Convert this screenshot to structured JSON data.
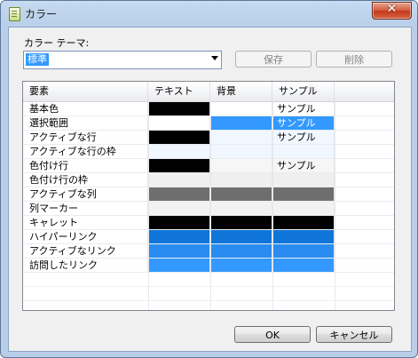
{
  "window": {
    "title": "カラー",
    "close_glyph": "✕"
  },
  "theme": {
    "label": "カラー テーマ:",
    "selected": "標準"
  },
  "buttons": {
    "save": "保存",
    "delete": "削除",
    "ok": "OK",
    "cancel": "キャンセル"
  },
  "table": {
    "headers": [
      "要素",
      "テキスト",
      "背景",
      "サンプル"
    ],
    "rows": [
      {
        "name": "基本色",
        "text_color": "#000000",
        "bg_color": "#ffffff",
        "sample": "サンプル",
        "sample_fg": "#000000",
        "sample_bg": "#ffffff"
      },
      {
        "name": "選択範囲",
        "text_color": "#ffffff",
        "bg_color": "#3399ff",
        "sample": "サンプル",
        "sample_fg": "#ffffff",
        "sample_bg": "#3399ff"
      },
      {
        "name": "アクティブな行",
        "text_color": "#000000",
        "bg_color": "#f0f7ff",
        "sample": "サンプル",
        "sample_fg": "#000000",
        "sample_bg": "#f0f7ff"
      },
      {
        "name": "アクティブな行の枠",
        "text_color": "#f0f7ff",
        "bg_color": "#f0f7ff",
        "sample": "",
        "sample_fg": "#000000",
        "sample_bg": "#f0f7ff"
      },
      {
        "name": "色付け行",
        "text_color": "#000000",
        "bg_color": "#f6f6f6",
        "sample": "サンプル",
        "sample_fg": "#000000",
        "sample_bg": "#f6f6f6"
      },
      {
        "name": "色付け行の枠",
        "text_color": "#efefef",
        "bg_color": "#efefef",
        "sample": "",
        "sample_fg": "#000000",
        "sample_bg": "#efefef"
      },
      {
        "name": "アクティブな列",
        "text_color": "#6e6e6e",
        "bg_color": "#6e6e6e",
        "sample": "",
        "sample_fg": "#000000",
        "sample_bg": "#6e6e6e"
      },
      {
        "name": "列マーカー",
        "text_color": "#f2f2f2",
        "bg_color": "#f2f2f2",
        "sample": "",
        "sample_fg": "#000000",
        "sample_bg": "#f2f2f2"
      },
      {
        "name": "キャレット",
        "text_color": "#000000",
        "bg_color": "#000000",
        "sample": "",
        "sample_fg": "#000000",
        "sample_bg": "#000000"
      },
      {
        "name": "ハイパーリンク",
        "text_color": "#0f75d9",
        "bg_color": "#0f75d9",
        "sample": "",
        "sample_fg": "#000000",
        "sample_bg": "#0f75d9"
      },
      {
        "name": "アクティブなリンク",
        "text_color": "#2a8cf0",
        "bg_color": "#2a8cf0",
        "sample": "",
        "sample_fg": "#000000",
        "sample_bg": "#2a8cf0"
      },
      {
        "name": "訪問したリンク",
        "text_color": "#3399ff",
        "bg_color": "#3399ff",
        "sample": "",
        "sample_fg": "#000000",
        "sample_bg": "#3399ff"
      }
    ],
    "blank_rows": 3
  },
  "colors": {
    "accent": "#3399ff",
    "close_red": "#c4391b",
    "frame": "#b9cfe9"
  }
}
